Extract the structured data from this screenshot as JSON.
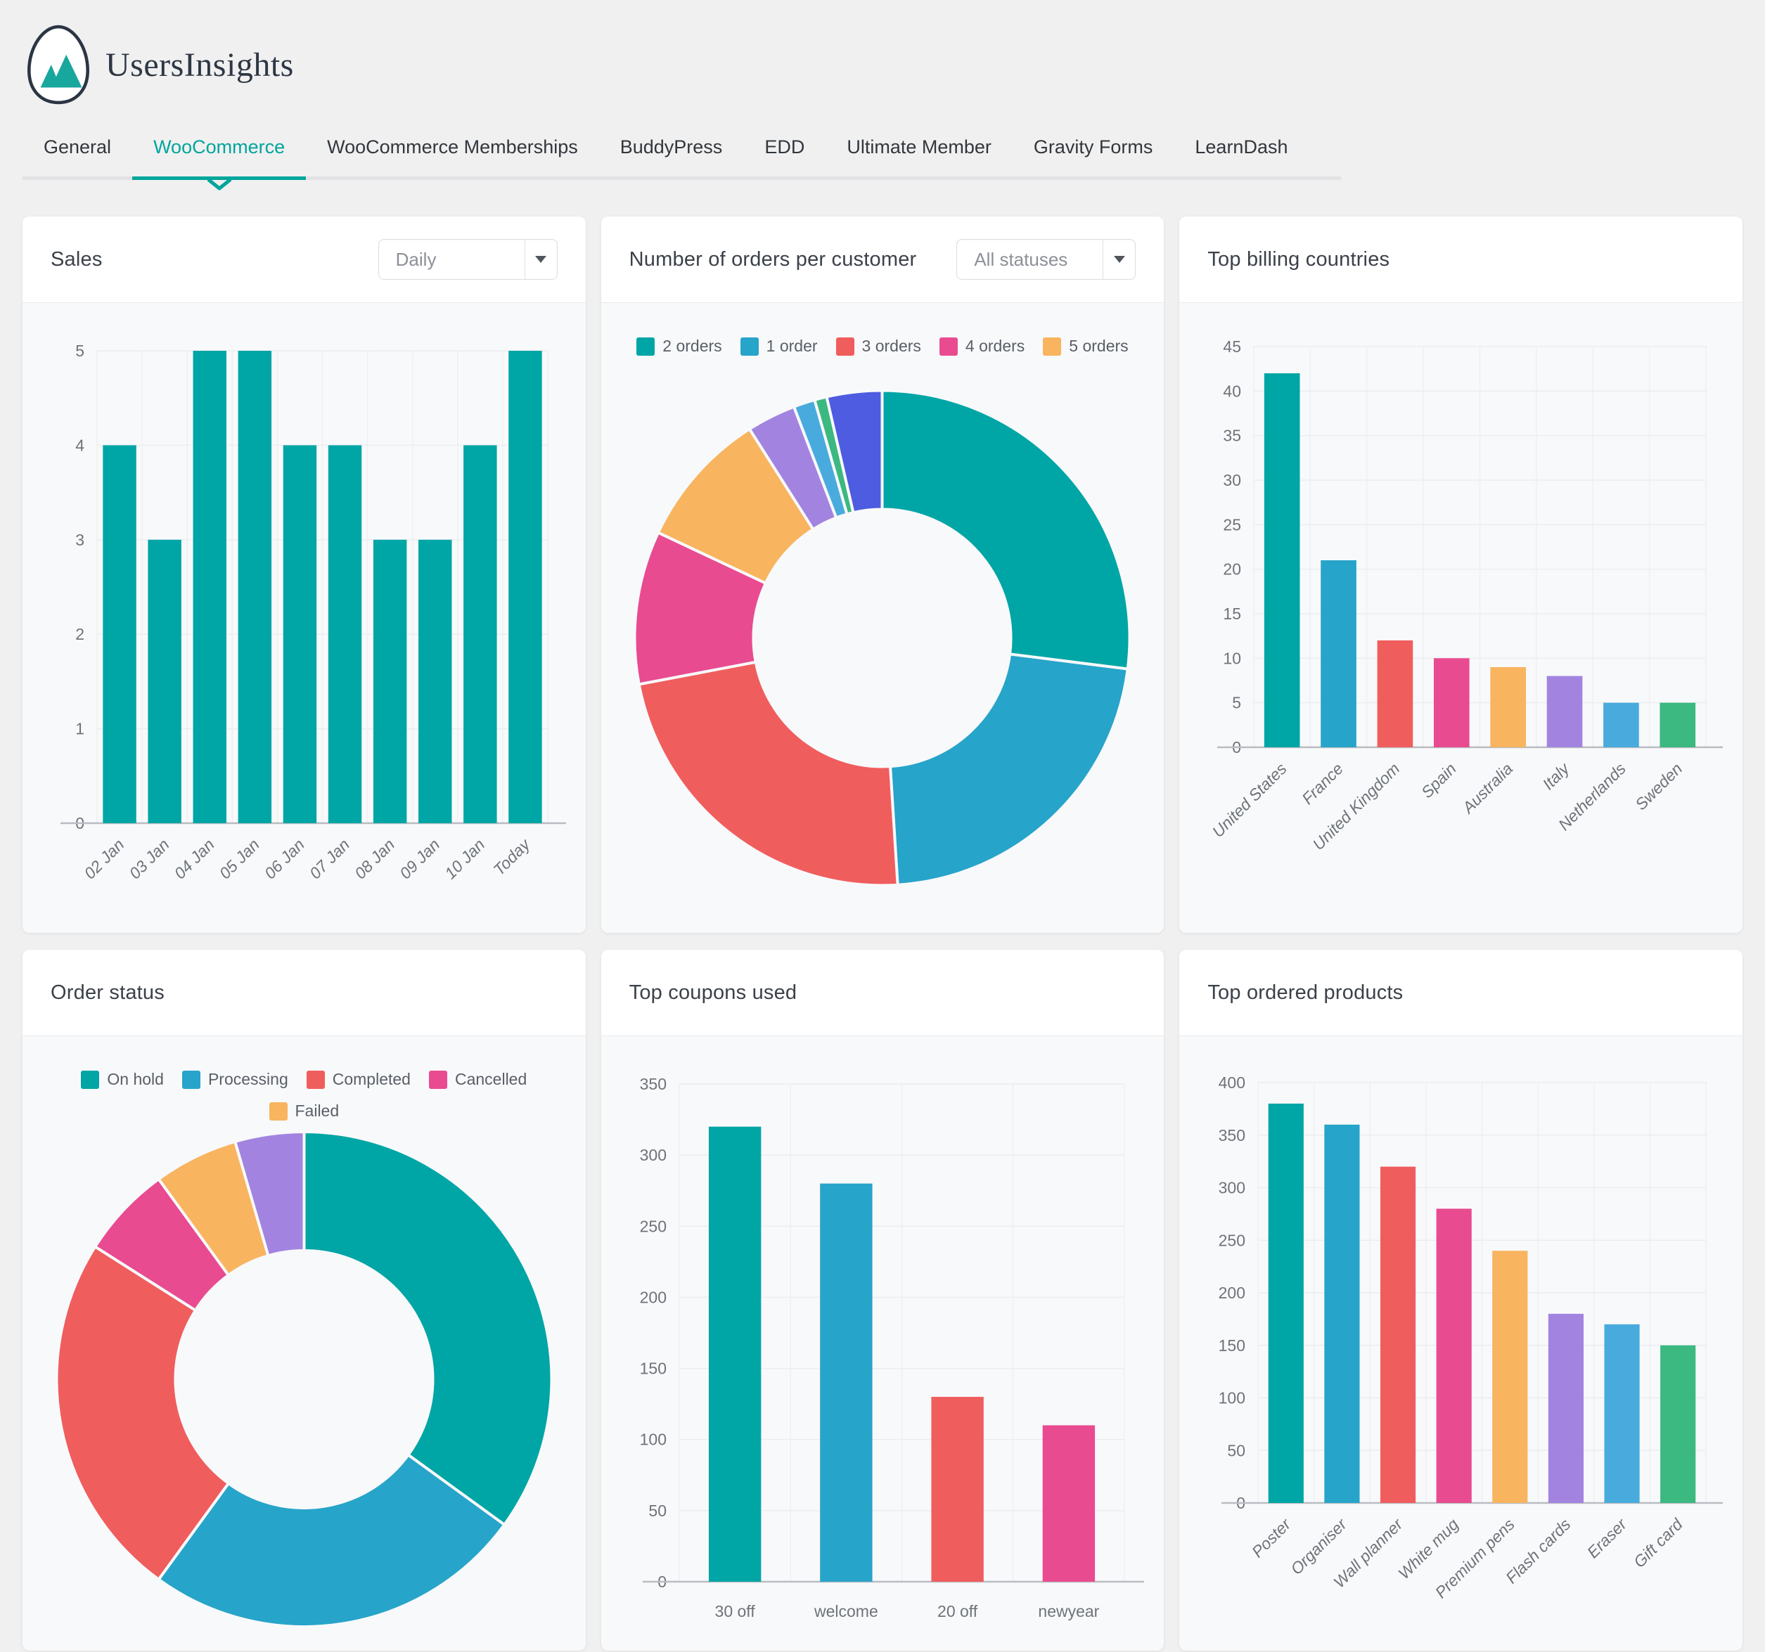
{
  "logo": {
    "text": "UsersInsights",
    "icon": "mountains-in-egg-logo"
  },
  "tabs": [
    {
      "label": "General",
      "active": false
    },
    {
      "label": "WooCommerce",
      "active": true
    },
    {
      "label": "WooCommerce Memberships",
      "active": false
    },
    {
      "label": "BuddyPress",
      "active": false
    },
    {
      "label": "EDD",
      "active": false
    },
    {
      "label": "Ultimate Member",
      "active": false
    },
    {
      "label": "Gravity Forms",
      "active": false
    },
    {
      "label": "LearnDash",
      "active": false
    }
  ],
  "colors": {
    "brand_teal": "#00a59b",
    "teal": "#00a5a5",
    "blue": "#27a4c9",
    "red": "#f05d5d",
    "pink": "#e84b90",
    "orange": "#f8b45f",
    "purple": "#a284e0",
    "light_blue": "#49abdd",
    "green": "#3cb881",
    "indigo": "#4d5ce0"
  },
  "chart_data": [
    {
      "id": "sales",
      "panel_title": "Sales",
      "select_value": "Daily",
      "type": "bar",
      "categories": [
        "02 Jan",
        "03 Jan",
        "04 Jan",
        "05 Jan",
        "06 Jan",
        "07 Jan",
        "08 Jan",
        "09 Jan",
        "10 Jan",
        "Today"
      ],
      "values": [
        4,
        3,
        5,
        5,
        4,
        4,
        3,
        3,
        4,
        5
      ],
      "color": "#00a5a5",
      "ylim": [
        0,
        5
      ],
      "ystep": 1,
      "x_label_rotation": 45,
      "grid": true,
      "legend_position": "none"
    },
    {
      "id": "orders-per-customer",
      "panel_title": "Number of orders per customer",
      "select_value": "All statuses",
      "type": "donut",
      "legend_position": "top",
      "segments": [
        {
          "label": "2 orders",
          "value": 27,
          "color": "#00a5a5"
        },
        {
          "label": "1 order",
          "value": 22,
          "color": "#27a4c9"
        },
        {
          "label": "3 orders",
          "value": 23,
          "color": "#f05d5d"
        },
        {
          "label": "4 orders",
          "value": 10,
          "color": "#e84b90"
        },
        {
          "label": "5 orders",
          "value": 9,
          "color": "#f8b45f"
        },
        {
          "label": "",
          "value": 3.2,
          "color": "#a284e0"
        },
        {
          "label": "",
          "value": 1.4,
          "color": "#49abdd"
        },
        {
          "label": "",
          "value": 0.8,
          "color": "#3cb881"
        },
        {
          "label": "",
          "value": 3.6,
          "color": "#4d5ce0"
        }
      ]
    },
    {
      "id": "top-billing-countries",
      "panel_title": "Top billing countries",
      "type": "bar",
      "categories": [
        "United States",
        "France",
        "United Kingdom",
        "Spain",
        "Australia",
        "Italy",
        "Netherlands",
        "Sweden"
      ],
      "values": [
        42,
        21,
        12,
        10,
        9,
        8,
        5,
        5
      ],
      "colors": [
        "#00a5a5",
        "#27a4c9",
        "#f05d5d",
        "#e84b90",
        "#f8b45f",
        "#a284e0",
        "#49abdd",
        "#3cb881"
      ],
      "ylim": [
        0,
        45
      ],
      "ystep": 5,
      "x_label_rotation": 45,
      "grid": true,
      "legend_position": "none"
    },
    {
      "id": "order-status",
      "panel_title": "Order status",
      "type": "donut",
      "legend_position": "top",
      "segments": [
        {
          "label": "On hold",
          "value": 35,
          "color": "#00a5a5"
        },
        {
          "label": "Processing",
          "value": 25,
          "color": "#27a4c9"
        },
        {
          "label": "Completed",
          "value": 24,
          "color": "#f05d5d"
        },
        {
          "label": "Cancelled",
          "value": 6,
          "color": "#e84b90"
        },
        {
          "label": "Failed",
          "value": 5.5,
          "color": "#f8b45f"
        },
        {
          "label": "",
          "value": 4.5,
          "color": "#a284e0"
        }
      ]
    },
    {
      "id": "top-coupons-used",
      "panel_title": "Top coupons used",
      "type": "bar",
      "categories": [
        "30 off",
        "welcome",
        "20 off",
        "newyear"
      ],
      "values": [
        320,
        280,
        130,
        110
      ],
      "colors": [
        "#00a5a5",
        "#27a4c9",
        "#f05d5d",
        "#e84b90"
      ],
      "ylim": [
        0,
        350
      ],
      "ystep": 50,
      "x_label_rotation": 0,
      "grid": true,
      "legend_position": "none"
    },
    {
      "id": "top-ordered-products",
      "panel_title": "Top ordered products",
      "type": "bar",
      "categories": [
        "Poster",
        "Organiser",
        "Wall planner",
        "White mug",
        "Premium pens",
        "Flash cards",
        "Eraser",
        "Gift card"
      ],
      "values": [
        380,
        360,
        320,
        280,
        240,
        180,
        170,
        150
      ],
      "colors": [
        "#00a5a5",
        "#27a4c9",
        "#f05d5d",
        "#e84b90",
        "#f8b45f",
        "#a284e0",
        "#49abdd",
        "#3cb881"
      ],
      "ylim": [
        0,
        400
      ],
      "ystep": 50,
      "x_label_rotation": 45,
      "grid": true,
      "legend_position": "none"
    }
  ]
}
